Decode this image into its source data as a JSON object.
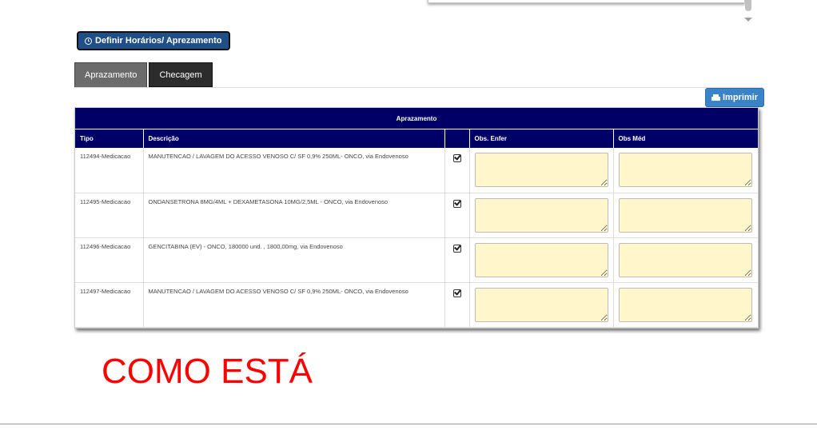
{
  "toolbar": {
    "define_label": "Definir Horários/ Aprezamento",
    "print_label": "Imprimir"
  },
  "tabs": [
    {
      "label": "Aprazamento",
      "active": true
    },
    {
      "label": "Checagem",
      "active": false
    }
  ],
  "table": {
    "caption": "Aprazamento",
    "headers": [
      "Tipo",
      "Descrição",
      "",
      "Obs. Enfer",
      "Obs Méd"
    ],
    "rows": [
      {
        "tipo": "112494-Medicacao",
        "descricao": "MANUTENCAO / LAVAGEM DO ACESSO VENOSO C/ SF 0,9% 250ML- ONCO, via Endovenoso",
        "checked": true,
        "obs_enfer": "",
        "obs_med": ""
      },
      {
        "tipo": "112495-Medicacao",
        "descricao": "ONDANSETRONA 8MG/4ML + DEXAMETASONA 10MG/2,5ML - ONCO, via Endovenoso",
        "checked": true,
        "obs_enfer": "",
        "obs_med": ""
      },
      {
        "tipo": "112496-Medicacao",
        "descricao": "GENCITABINA (EV) - ONCO, 180000 und. , 1800,00mg, via Endovenoso",
        "checked": true,
        "obs_enfer": "",
        "obs_med": ""
      },
      {
        "tipo": "112497-Medicacao",
        "descricao": "MANUTENCAO / LAVAGEM DO ACESSO VENOSO C/ SF 0,9% 250ML- ONCO, via Endovenoso",
        "checked": true,
        "obs_enfer": "",
        "obs_med": ""
      }
    ]
  },
  "annotation": {
    "text": "COMO ESTÁ",
    "color": "#ff0000"
  },
  "colors": {
    "header_bg": "#000066",
    "define_button_bg": "#1f4f86",
    "print_button_bg": "#3a83c6",
    "textarea_bg": "#fff6cc"
  },
  "icons": {
    "define_button": "clock-icon",
    "print_button": "printer-icon",
    "row_check": "checkbox-checked-icon"
  }
}
